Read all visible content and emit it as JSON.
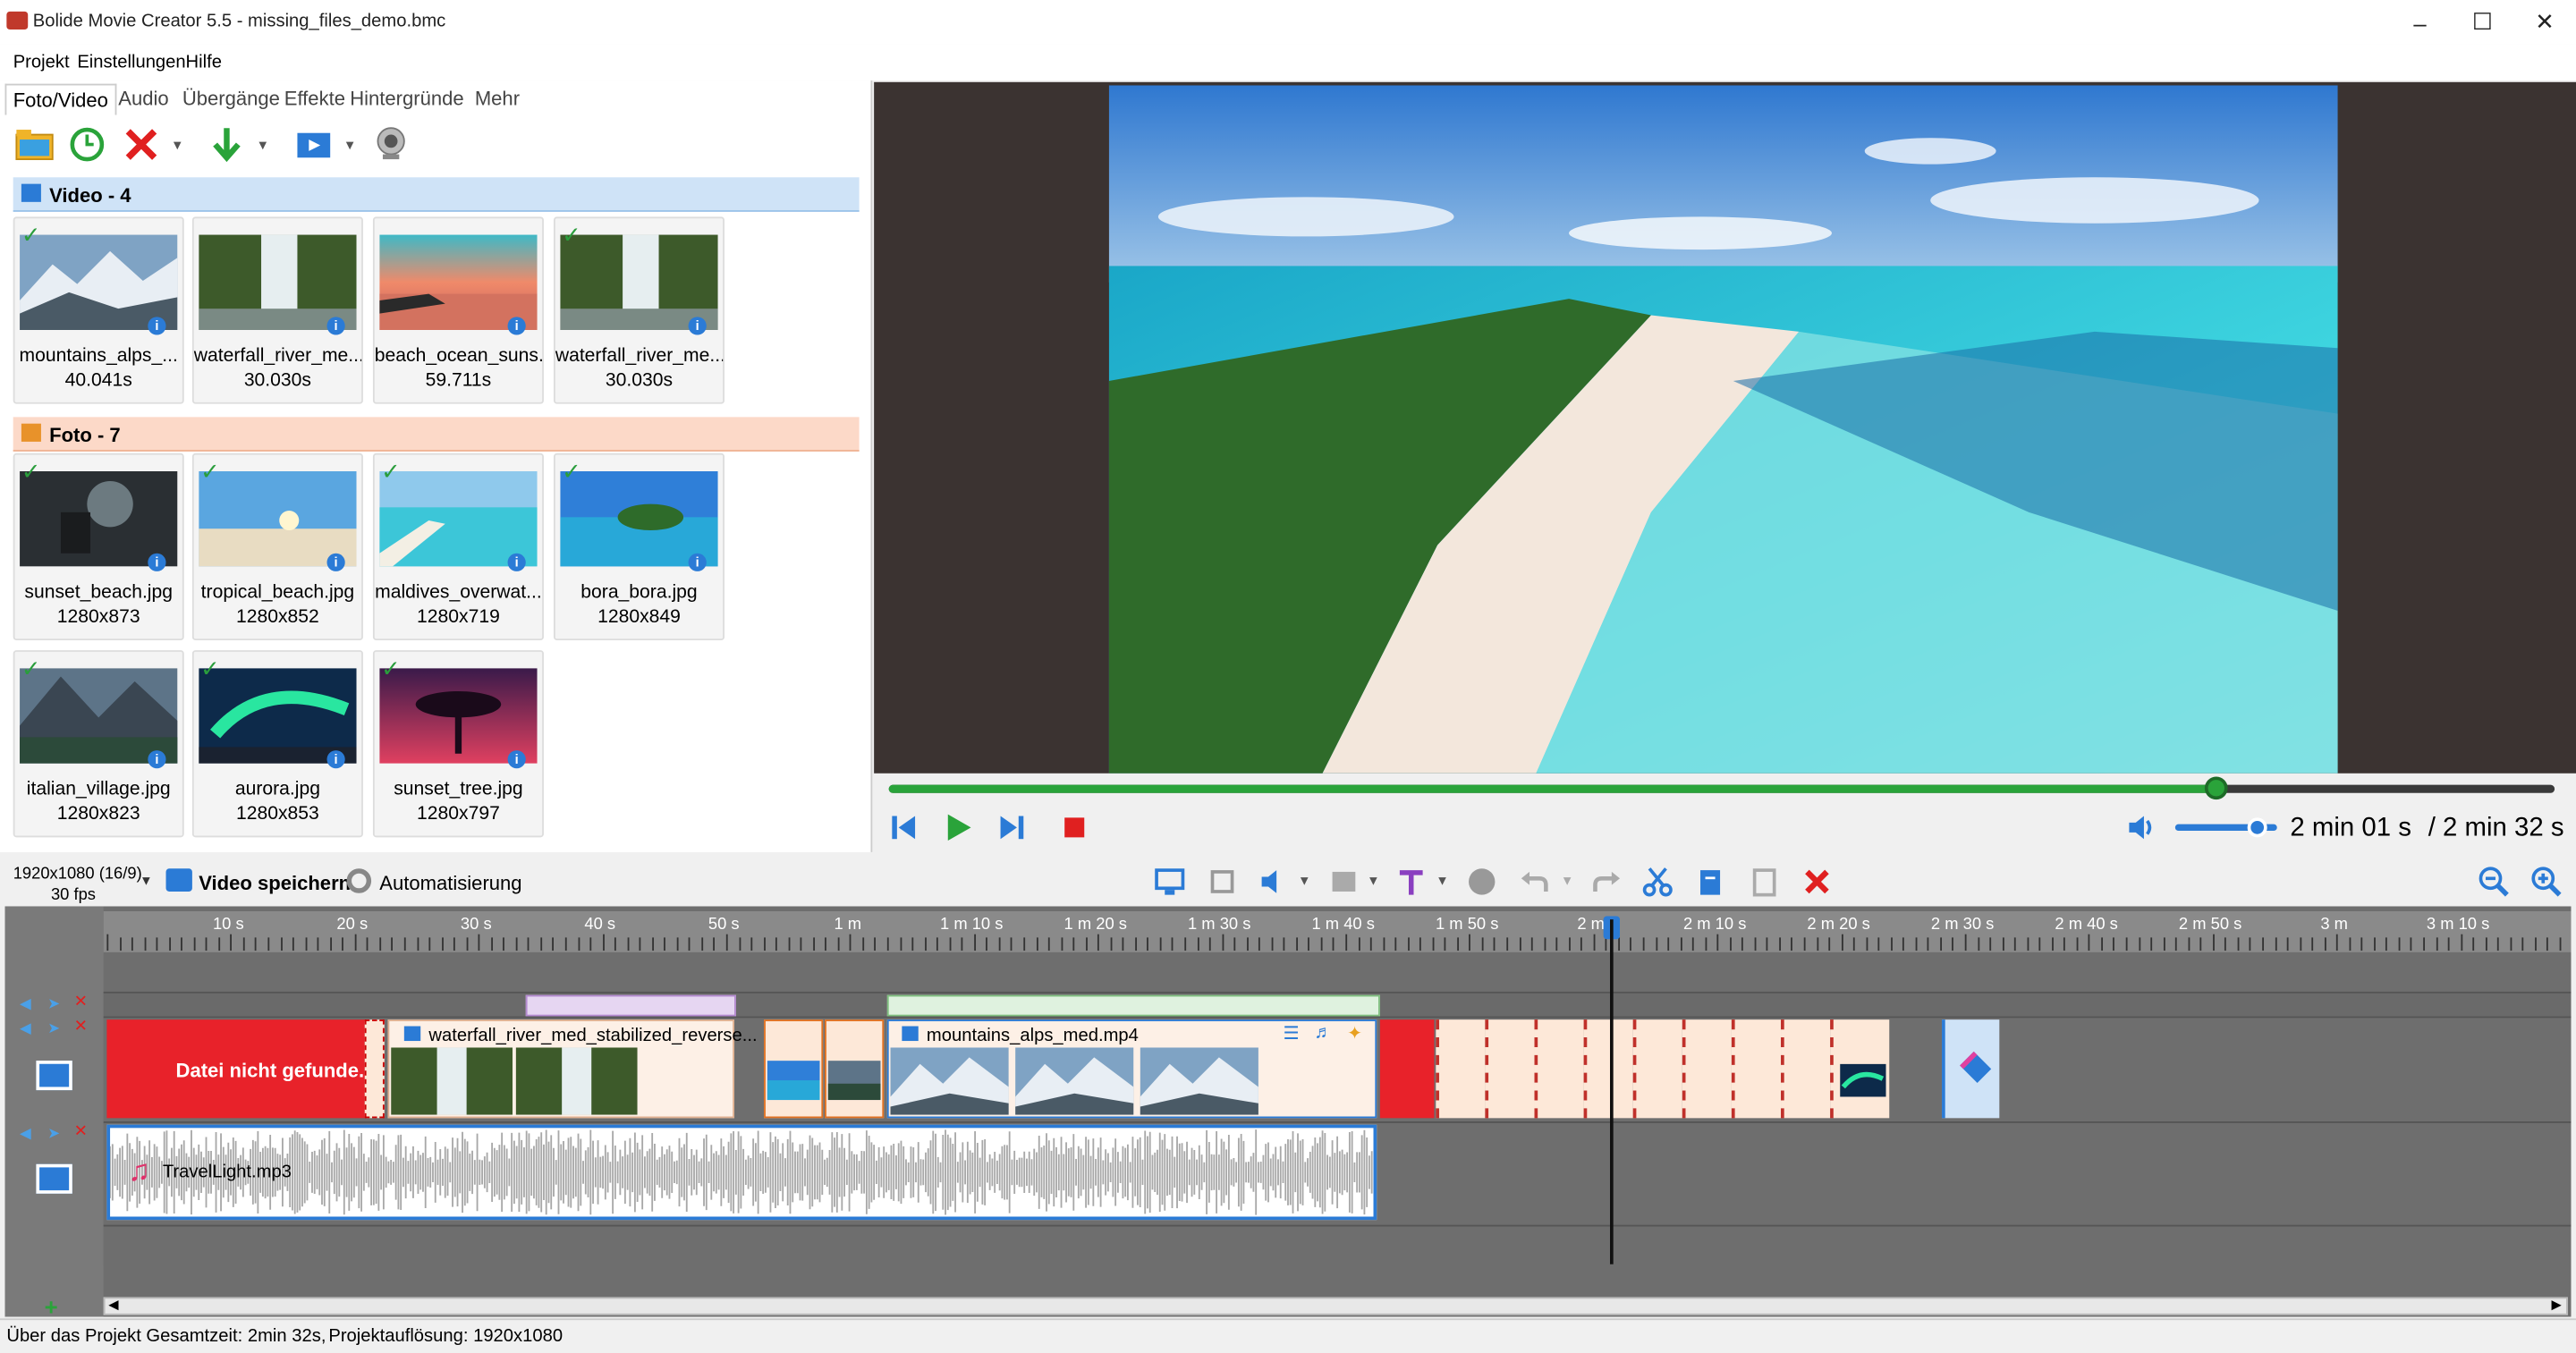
{
  "window": {
    "title": "Bolide Movie Creator 5.5 - missing_files_demo.bmc"
  },
  "menu": {
    "items": [
      "Projekt",
      "Einstellungen",
      "Hilfe"
    ]
  },
  "tabs": {
    "items": [
      "Foto/Video",
      "Audio",
      "Übergänge",
      "Effekte",
      "Hintergründe",
      "Mehr"
    ]
  },
  "library": {
    "video_group": "Video - 4",
    "video_items": [
      {
        "name": "mountains_alps_...",
        "duration": "40.041s",
        "checked": true
      },
      {
        "name": "waterfall_river_me...",
        "duration": "30.030s",
        "checked": false
      },
      {
        "name": "beach_ocean_suns...",
        "duration": "59.711s",
        "checked": false
      },
      {
        "name": "waterfall_river_me...",
        "duration": "30.030s",
        "checked": true
      }
    ],
    "photo_group": "Foto - 7",
    "photo_items": [
      {
        "name": "sunset_beach.jpg",
        "size": "1280x873"
      },
      {
        "name": "tropical_beach.jpg",
        "size": "1280x852"
      },
      {
        "name": "maldives_overwat...",
        "size": "1280x719"
      },
      {
        "name": "bora_bora.jpg",
        "size": "1280x849"
      },
      {
        "name": "italian_village.jpg",
        "size": "1280x823"
      },
      {
        "name": "aurora.jpg",
        "size": "1280x853"
      },
      {
        "name": "sunset_tree.jpg",
        "size": "1280x797"
      }
    ]
  },
  "player": {
    "current_time": "2 min 01 s",
    "total_time": "/ 2 min 32 s",
    "progress": 0.797,
    "volume": 0.8
  },
  "timeline_toolbar": {
    "resolution": "1920x1080 (16/9)",
    "fps": "30 fps",
    "save_video": "Video speichern",
    "automation": "Automatisierung"
  },
  "ruler": {
    "labels": [
      "10 s",
      "20 s",
      "30 s",
      "40 s",
      "50 s",
      "1 m",
      "1 m 10 s",
      "1 m 20 s",
      "1 m 30 s",
      "1 m 40 s",
      "1 m 50 s",
      "2 m",
      "2 m 10 s",
      "2 m 20 s",
      "2 m 30 s",
      "2 m 40 s",
      "2 m 50 s",
      "3 m",
      "3 m 10 s"
    ]
  },
  "clips": {
    "missing": "Datei nicht gefunde...",
    "waterfall": "waterfall_river_med_stabilized_reverse...",
    "mountains": "mountains_alps_med.mp4",
    "audio": "TravelLight.mp3"
  },
  "status": {
    "project_info": "Über das Projekt Gesamtzeit: 2min 32s,",
    "resolution": "Projektauflösung:  1920x1080"
  }
}
